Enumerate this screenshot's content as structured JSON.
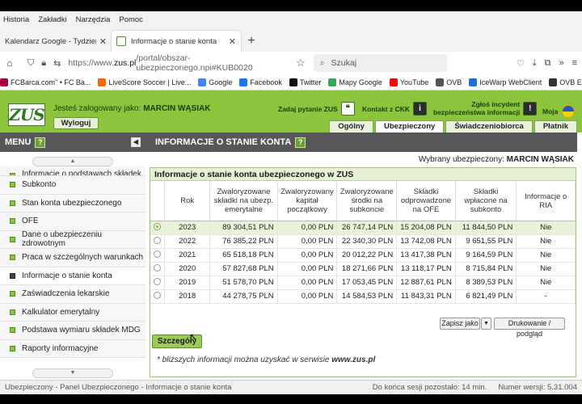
{
  "browser": {
    "menu": [
      {
        "label": "Historia",
        "accel": "H"
      },
      {
        "label": "Zakładki",
        "accel": "Z"
      },
      {
        "label": "Narzędzia",
        "accel": "N"
      },
      {
        "label": "Pomoc",
        "accel": "P"
      }
    ],
    "tabs": [
      {
        "title": "Kalendarz Google - Tydzień, w"
      },
      {
        "title": "Informacje o stanie konta"
      }
    ],
    "url": {
      "prefix": "https://www.",
      "host": "zus.pl",
      "path": "/portal/obszar-ubezpieczonego.npi#KUB0020"
    },
    "search_placeholder": "Szukaj",
    "bookmarks": [
      {
        "label": "FCBarca.com\" • FC Ba...",
        "color": "#a50044"
      },
      {
        "label": "LiveScore Soccer | Live...",
        "color": "#ff6a00"
      },
      {
        "label": "Google",
        "color": "#4285f4"
      },
      {
        "label": "Facebook",
        "color": "#1877f2"
      },
      {
        "label": "Twitter",
        "color": "#111111"
      },
      {
        "label": "Mapy Google",
        "color": "#34a853"
      },
      {
        "label": "YouTube",
        "color": "#ff0000"
      },
      {
        "label": "OVB",
        "color": "#555555"
      },
      {
        "label": "IceWarp WebClient",
        "color": "#1e6fd9"
      },
      {
        "label": "OVB EASY",
        "color": "#333333"
      }
    ]
  },
  "header": {
    "logo": "ZUS",
    "logged_prefix": "Jesteś zalogowany jako:",
    "user": "MARCIN WĄSIAK",
    "logout": "Wyloguj",
    "ask": "Zadaj pytanie ZUS",
    "contact": "Kontakt z CKK",
    "incident_1": "Zgłoś incydent",
    "incident_2": "bezpieczeństwa informacji",
    "lang": "Moja",
    "tabs": [
      "Ogólny",
      "Ubezpieczony",
      "Świadczeniobiorca",
      "Płatnik"
    ],
    "active_tab": "Ubezpieczony"
  },
  "menu": {
    "title": "MENU",
    "items": [
      {
        "label": "Informacje o podstawach składek"
      },
      {
        "label": "Subkonto"
      },
      {
        "label": "Stan konta ubezpieczonego"
      },
      {
        "label": "OFE"
      },
      {
        "label": "Dane o ubezpieczeniu zdrowotnym"
      },
      {
        "label": "Praca w szczególnych warunkach"
      },
      {
        "label": "Informacje o stanie konta",
        "current": true
      },
      {
        "label": "Zaświadczenia lekarskie"
      },
      {
        "label": "Kalkulator emerytalny"
      },
      {
        "label": "Podstawa wymiaru składek MDG"
      },
      {
        "label": "Raporty informacyjne"
      }
    ]
  },
  "content": {
    "title": "INFORMACJE O STANIE KONTA",
    "selected_label": "Wybrany ubezpieczony:",
    "selected_name": "MARCIN WĄSIAK",
    "box_title": "Informacje o stanie konta ubezpieczonego w ZUS",
    "columns": [
      "Rok",
      "Zwaloryzowane składki na ubezp. emerytalne",
      "Zwaloryzowany kapitał początkowy",
      "Zwaloryzowane środki na subkoncie",
      "Składki odprowadzone na OFE",
      "Składki wpłacone na subkonto",
      "Informacje o RIA"
    ],
    "rows": [
      [
        "2023",
        "89 304,51 PLN",
        "0,00 PLN",
        "26 747,14 PLN",
        "15 204,08 PLN",
        "11 844,50 PLN",
        "Nie"
      ],
      [
        "2022",
        "76 385,22 PLN",
        "0,00 PLN",
        "22 340,30 PLN",
        "13 742,08 PLN",
        "9 651,55 PLN",
        "Nie"
      ],
      [
        "2021",
        "65 518,18 PLN",
        "0,00 PLN",
        "20 012,22 PLN",
        "13 417,38 PLN",
        "9 164,59 PLN",
        "Nie"
      ],
      [
        "2020",
        "57 827,68 PLN",
        "0,00 PLN",
        "18 271,66 PLN",
        "13 118,17 PLN",
        "8 715,84 PLN",
        "Nie"
      ],
      [
        "2019",
        "51 578,70 PLN",
        "0,00 PLN",
        "17 053,45 PLN",
        "12 887,61 PLN",
        "8 389,53 PLN",
        "Nie"
      ],
      [
        "2018",
        "44 278,75 PLN",
        "0,00 PLN",
        "14 584,53 PLN",
        "11 843,31 PLN",
        "6 821,49 PLN",
        "-"
      ]
    ],
    "selected_row": 0,
    "save_as": "Zapisz jako",
    "print": "Drukowanie / podgląd",
    "details": "Szczegóły",
    "footnote_text": "* bliższych informacji można uzyskać w serwisie",
    "footnote_link": "www.zus.pl"
  },
  "status": {
    "left": "Ubezpieczony - Panel Ubezpieczonego - Informacje o stanie konta",
    "session": "Do końca sesji pozostało: 14 min.",
    "version": "Numer wersji: 5.31.004"
  }
}
